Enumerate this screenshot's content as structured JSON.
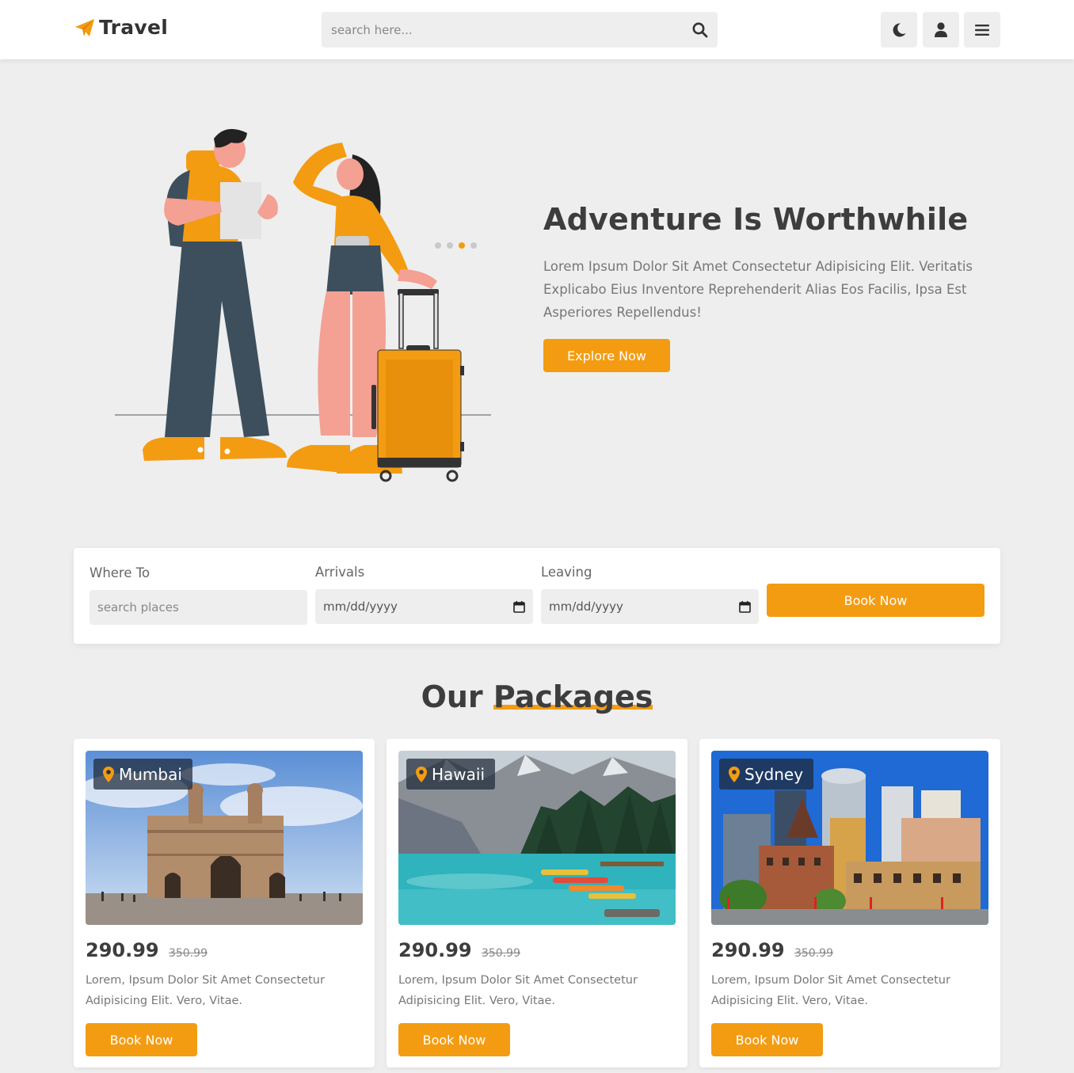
{
  "brand": {
    "name": "Travel",
    "accent": "#f39c12"
  },
  "header": {
    "search_placeholder": "search here...",
    "icons": [
      "moon-icon",
      "user-icon",
      "menu-icon"
    ]
  },
  "hero": {
    "title": "Adventure Is Worthwhile",
    "text": "Lorem Ipsum Dolor Sit Amet Consectetur Adipisicing Elit. Veritatis Explicabo Eius Inventore Reprehenderit Alias Eos Facilis, Ipsa Est Asperiores Repellendus!",
    "button": "Explore Now",
    "slider_dots": 4,
    "active_dot": 3
  },
  "booking": {
    "where_label": "Where To",
    "where_placeholder": "search places",
    "arrivals_label": "Arrivals",
    "arrivals_value": "mm/dd/yyyy",
    "leaving_label": "Leaving",
    "leaving_value": "mm/dd/yyyy",
    "button": "Book Now"
  },
  "packages": {
    "title_part1": "Our",
    "title_part2": "Packages",
    "items": [
      {
        "location": "Mumbai",
        "price": "290.99",
        "old_price": "350.99",
        "text": "Lorem, Ipsum Dolor Sit Amet Consectetur Adipisicing Elit. Vero, Vitae.",
        "button": "Book Now"
      },
      {
        "location": "Hawaii",
        "price": "290.99",
        "old_price": "350.99",
        "text": "Lorem, Ipsum Dolor Sit Amet Consectetur Adipisicing Elit. Vero, Vitae.",
        "button": "Book Now"
      },
      {
        "location": "Sydney",
        "price": "290.99",
        "old_price": "350.99",
        "text": "Lorem, Ipsum Dolor Sit Amet Consectetur Adipisicing Elit. Vero, Vitae.",
        "button": "Book Now"
      }
    ]
  }
}
